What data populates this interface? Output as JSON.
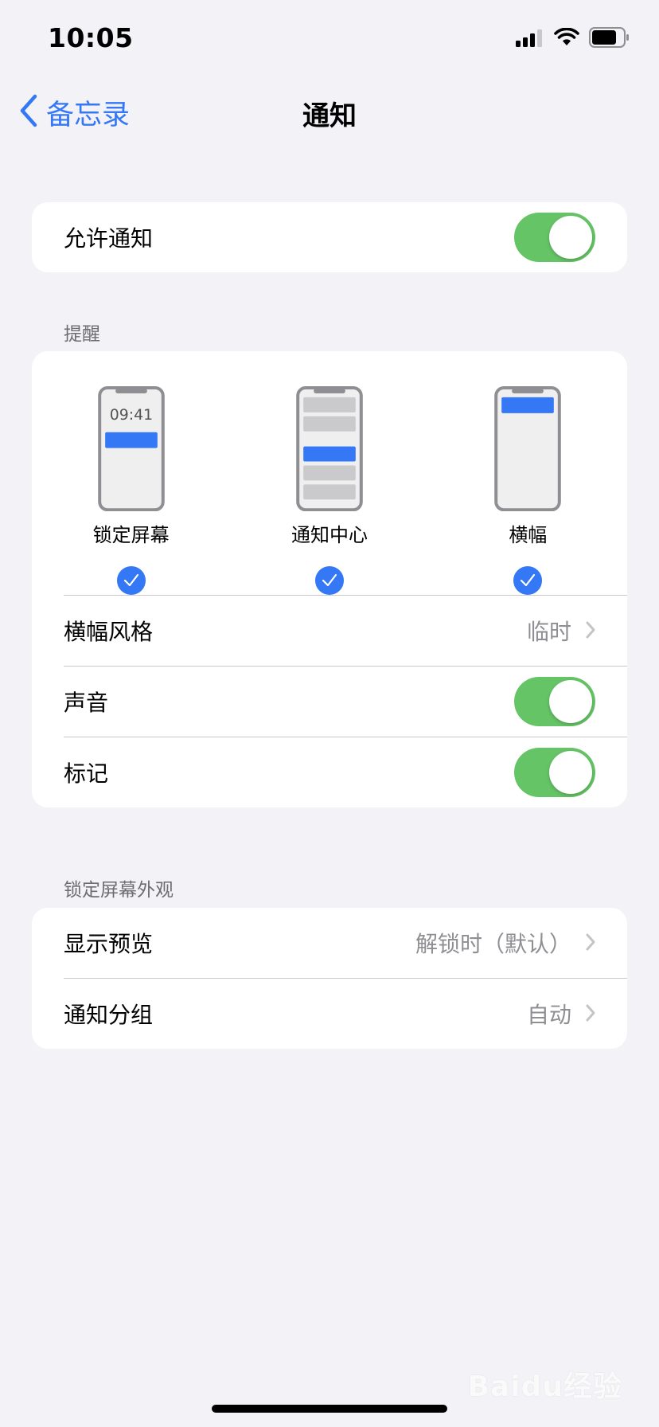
{
  "status_bar": {
    "time": "10:05"
  },
  "nav": {
    "back_label": "备忘录",
    "title": "通知"
  },
  "allow": {
    "label": "允许通知",
    "on": true
  },
  "alerts_section": {
    "header": "提醒",
    "options": [
      {
        "label": "锁定屏幕",
        "preview_time": "09:41",
        "checked": true
      },
      {
        "label": "通知中心",
        "checked": true
      },
      {
        "label": "横幅",
        "checked": true
      }
    ],
    "banner_style": {
      "label": "横幅风格",
      "value": "临时"
    },
    "sounds": {
      "label": "声音",
      "on": true
    },
    "badges": {
      "label": "标记",
      "on": true
    }
  },
  "lock_screen_section": {
    "header": "锁定屏幕外观",
    "show_previews": {
      "label": "显示预览",
      "value": "解锁时（默认）"
    },
    "grouping": {
      "label": "通知分组",
      "value": "自动"
    }
  },
  "watermark": "Baidu经验",
  "colors": {
    "accent": "#3478f6",
    "toggle_on": "#65c466",
    "background": "#f2f2f7"
  }
}
